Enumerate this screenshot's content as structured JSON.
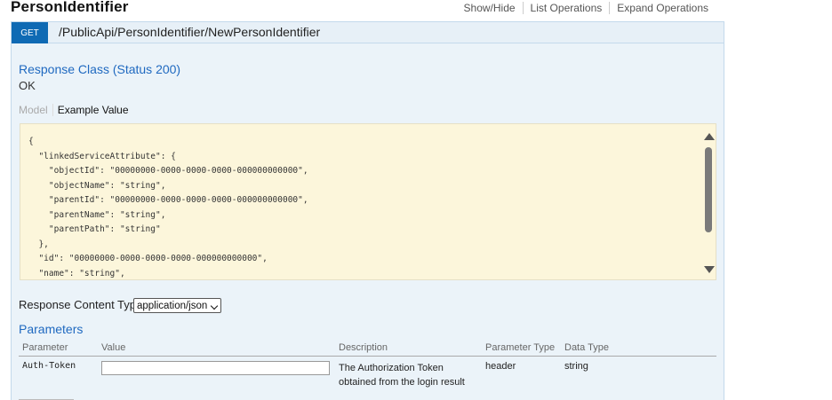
{
  "resource": {
    "title": "PersonIdentifier",
    "links": [
      "Show/Hide",
      "List Operations",
      "Expand Operations"
    ]
  },
  "operation": {
    "method": "GET",
    "path": "/PublicApi/PersonIdentifier/NewPersonIdentifier"
  },
  "response_class": {
    "title": "Response Class (Status 200)",
    "status_text": "OK"
  },
  "model_tabs": {
    "model": "Model",
    "example": "Example Value"
  },
  "example_value": "{\n  \"linkedServiceAttribute\": {\n    \"objectId\": \"00000000-0000-0000-0000-000000000000\",\n    \"objectName\": \"string\",\n    \"parentId\": \"00000000-0000-0000-0000-000000000000\",\n    \"parentName\": \"string\",\n    \"parentPath\": \"string\"\n  },\n  \"id\": \"00000000-0000-0000-0000-000000000000\",\n  \"name\": \"string\",",
  "response_content_type": {
    "label": "Response Content Type",
    "selected": "application/json"
  },
  "parameters": {
    "title": "Parameters",
    "columns": [
      "Parameter",
      "Value",
      "Description",
      "Parameter Type",
      "Data Type"
    ],
    "rows": [
      {
        "name": "Auth-Token",
        "value": "",
        "description": "The Authorization Token obtained from the login result",
        "param_type": "header",
        "data_type": "string"
      }
    ]
  },
  "colors": {
    "get_badge": "#0f6ab4",
    "link_blue": "#1f69c0",
    "panel_bg": "#ebf3f9",
    "example_bg": "#fcf6db"
  }
}
